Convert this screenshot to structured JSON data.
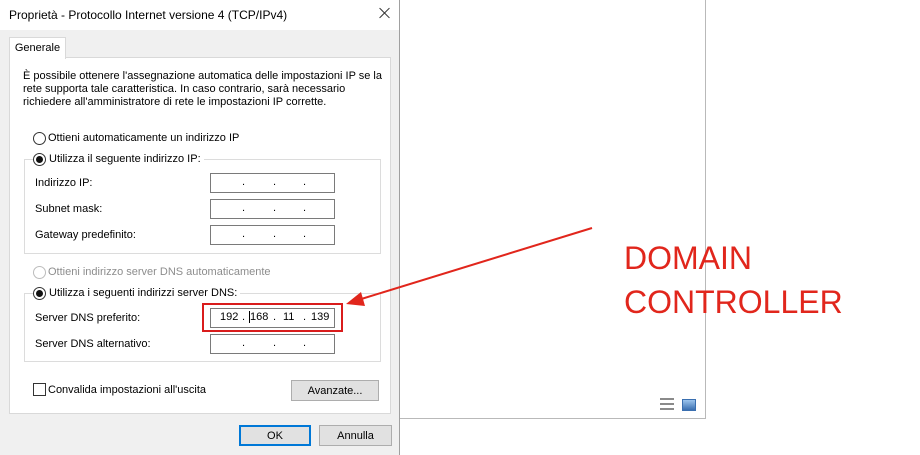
{
  "dialog": {
    "title": "Proprietà - Protocollo Internet versione 4 (TCP/IPv4)",
    "tab_label": "Generale",
    "description": "È possibile ottenere l'assegnazione automatica delle impostazioni IP se la rete supporta tale caratteristica. In caso contrario, sarà necessario richiedere all'amministratore di rete le impostazioni IP corrette.",
    "ip_auto_label": "Ottieni automaticamente un indirizzo IP",
    "ip_manual_label": "Utilizza il seguente indirizzo IP:",
    "ip_address_label": "Indirizzo IP:",
    "subnet_label": "Subnet mask:",
    "gateway_label": "Gateway predefinito:",
    "dns_auto_label": "Ottieni indirizzo server DNS automaticamente",
    "dns_manual_label": "Utilizza i seguenti indirizzi server DNS:",
    "dns_preferred_label": "Server DNS preferito:",
    "dns_alternate_label": "Server DNS alternativo:",
    "dns_preferred_octets": [
      "192",
      "168",
      "11",
      "139"
    ],
    "validate_label": "Convalida impostazioni all'uscita",
    "advanced_button": "Avanzate...",
    "ok_button": "OK",
    "cancel_button": "Annulla",
    "selected_ip_mode": "manual",
    "selected_dns_mode": "manual",
    "validate_checked": false
  },
  "annotation": {
    "line1": "DOMAIN",
    "line2": "CONTROLLER",
    "color": "#e1261c"
  }
}
